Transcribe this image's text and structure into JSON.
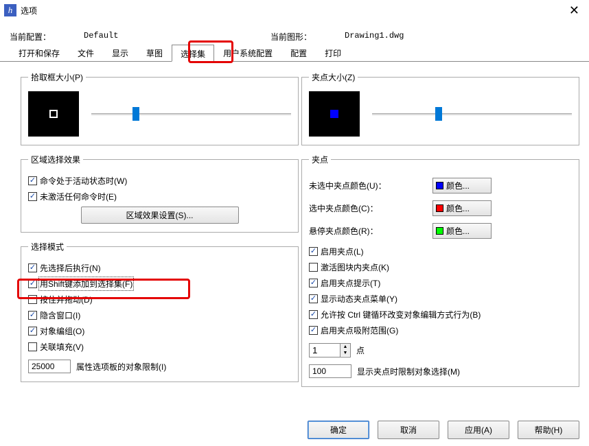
{
  "window": {
    "title": "选项"
  },
  "info": {
    "current_config_label": "当前配置：",
    "current_config_value": "Default",
    "current_drawing_label": "当前图形：",
    "current_drawing_value": "Drawing1.dwg"
  },
  "tabs": [
    {
      "label": "打开和保存"
    },
    {
      "label": "文件"
    },
    {
      "label": "显示"
    },
    {
      "label": "草图"
    },
    {
      "label": "选择集",
      "active": true
    },
    {
      "label": "用户系统配置"
    },
    {
      "label": "配置"
    },
    {
      "label": "打印"
    }
  ],
  "left": {
    "pickbox": {
      "legend": "拾取框大小(P)"
    },
    "region": {
      "legend": "区域选择效果",
      "active_cmd": {
        "label": "命令处于活动状态时(W)",
        "checked": true
      },
      "no_active": {
        "label": "未激活任何命令时(E)",
        "checked": true
      },
      "settings_btn": "区域效果设置(S)..."
    },
    "select": {
      "legend": "选择模式",
      "pre_select": {
        "label": "先选择后执行(N)",
        "checked": true
      },
      "shift_add": {
        "label": "用Shift键添加到选择集(F)",
        "checked": true
      },
      "press_drag": {
        "label": "按住并拖动(D)",
        "checked": false
      },
      "implied_win": {
        "label": "隐含窗口(I)",
        "checked": true
      },
      "obj_group": {
        "label": "对象编组(O)",
        "checked": true
      },
      "assoc_hatch": {
        "label": "关联填充(V)",
        "checked": false
      },
      "limit_value": "25000",
      "limit_label": "属性选项板的对象限制(I)"
    }
  },
  "right": {
    "grip_size": {
      "legend": "夹点大小(Z)"
    },
    "grips": {
      "legend": "夹点",
      "unsel_label": "未选中夹点颜色(U)：",
      "sel_label": "选中夹点颜色(C)：",
      "hover_label": "悬停夹点颜色(R)：",
      "color_btn": "颜色...",
      "color_unsel": "#0000ff",
      "color_sel": "#ff0000",
      "color_hover": "#00ff00",
      "enable": {
        "label": "启用夹点(L)",
        "checked": true
      },
      "in_block": {
        "label": "激活图块内夹点(K)",
        "checked": false
      },
      "tips": {
        "label": "启用夹点提示(T)",
        "checked": true
      },
      "dyn_menu": {
        "label": "显示动态夹点菜单(Y)",
        "checked": true
      },
      "ctrl_cycle": {
        "label": "允许按 Ctrl 键循环改变对象编辑方式行为(B)",
        "checked": true
      },
      "attract": {
        "label": "启用夹点吸附范围(G)",
        "checked": true
      },
      "spin_value": "1",
      "spin_label": "点",
      "limit_value": "100",
      "limit_label": "显示夹点时限制对象选择(M)"
    }
  },
  "footer": {
    "ok": "确定",
    "cancel": "取消",
    "apply": "应用(A)",
    "help": "帮助(H)"
  }
}
